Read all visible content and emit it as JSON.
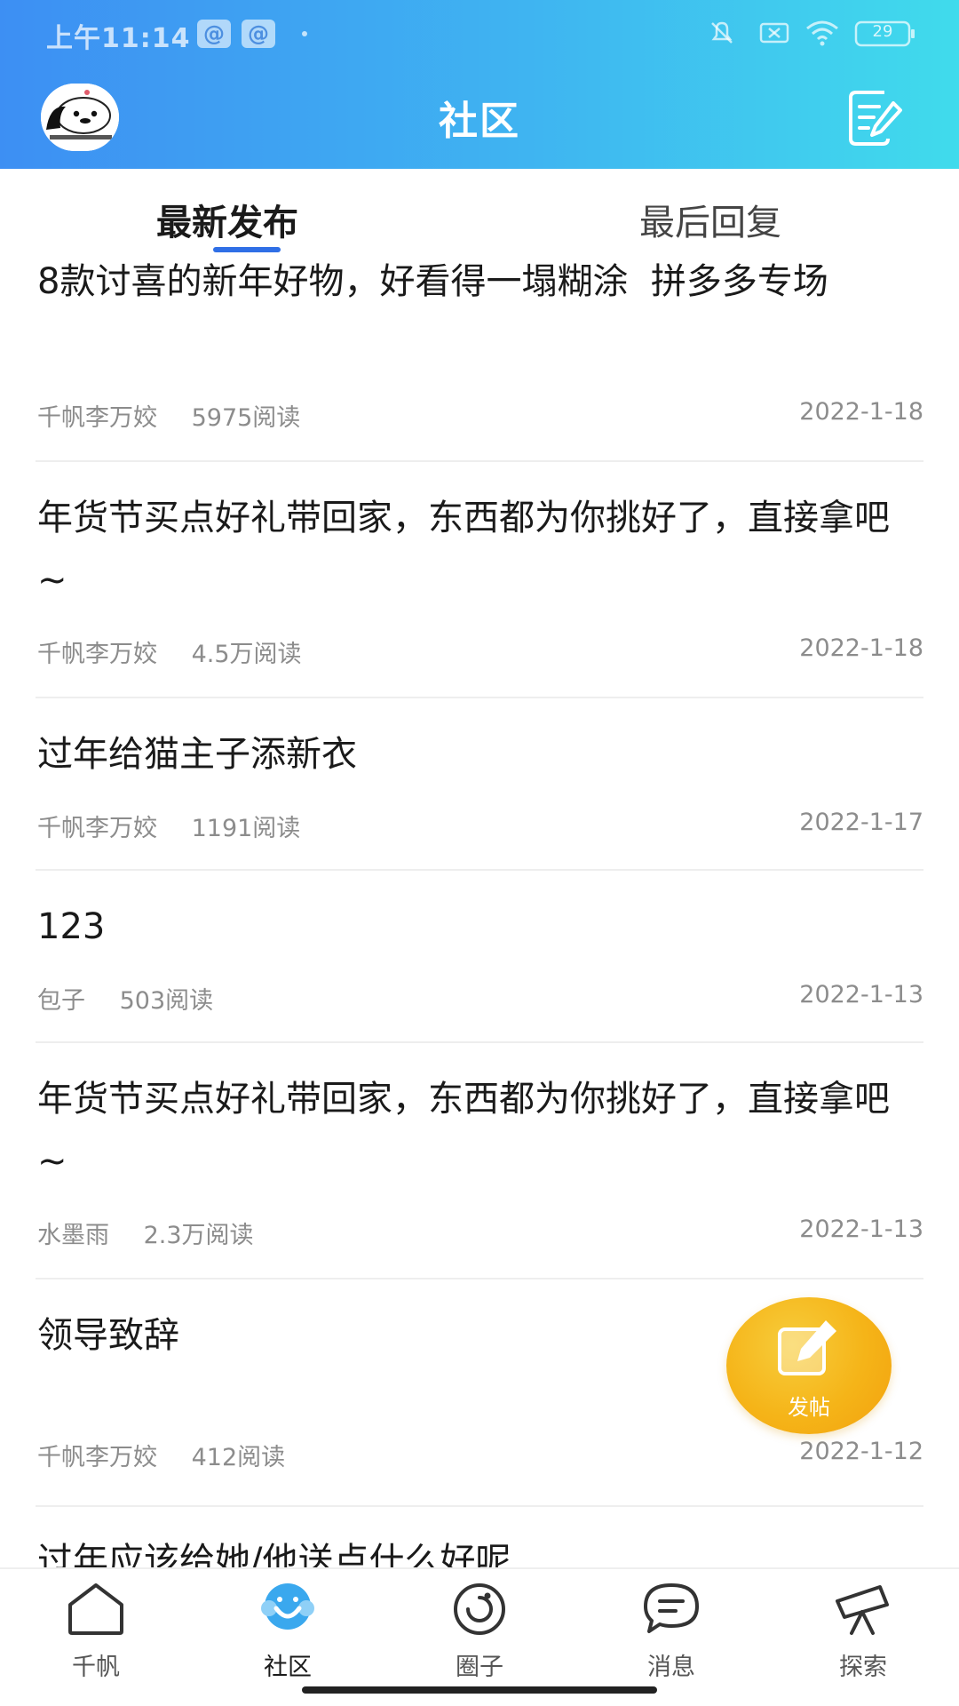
{
  "status_bar": {
    "time": "上午11:14",
    "app_icon_glyph": "@",
    "battery": "29"
  },
  "header": {
    "title": "社区",
    "avatar_icon": "avatar-image",
    "compose_icon": "edit-note-icon"
  },
  "tabs": [
    {
      "label": "最新发布",
      "active": true
    },
    {
      "label": "最后回复",
      "active": false
    }
  ],
  "posts": [
    {
      "title": "8款讨喜的新年好物，好看得一塌糊涂  拼多多专场",
      "author": "千帆李万姣",
      "reads": "5975阅读",
      "date": "2022-1-18"
    },
    {
      "title": "年货节买点好礼带回家，东西都为你挑好了，直接拿吧~",
      "author": "千帆李万姣",
      "reads": "4.5万阅读",
      "date": "2022-1-18"
    },
    {
      "title": "过年给猫主子添新衣",
      "author": "千帆李万姣",
      "reads": "1191阅读",
      "date": "2022-1-17"
    },
    {
      "title": "123",
      "author": "包子",
      "reads": "503阅读",
      "date": "2022-1-13"
    },
    {
      "title": "年货节买点好礼带回家，东西都为你挑好了，直接拿吧~",
      "author": "水墨雨",
      "reads": "2.3万阅读",
      "date": "2022-1-13"
    },
    {
      "title": "领导致辞",
      "author": "千帆李万姣",
      "reads": "412阅读",
      "date": "2022-1-12"
    },
    {
      "title": "过年应该给她/他送点什么好呢",
      "author": "",
      "reads": "",
      "date": ""
    }
  ],
  "fab": {
    "label": "发帖",
    "color": "#f5b418"
  },
  "bottom_nav": [
    {
      "label": "千帆",
      "icon": "home-icon",
      "active": false
    },
    {
      "label": "社区",
      "icon": "community-icon",
      "active": true
    },
    {
      "label": "圈子",
      "icon": "circle-icon",
      "active": false
    },
    {
      "label": "消息",
      "icon": "message-icon",
      "active": false
    },
    {
      "label": "探索",
      "icon": "telescope-icon",
      "active": false
    }
  ],
  "colors": {
    "header_start": "#3d8ff3",
    "header_end": "#40dbec",
    "tab_indicator": "#2f6fe6",
    "active_nav": "#3aa8ee"
  }
}
